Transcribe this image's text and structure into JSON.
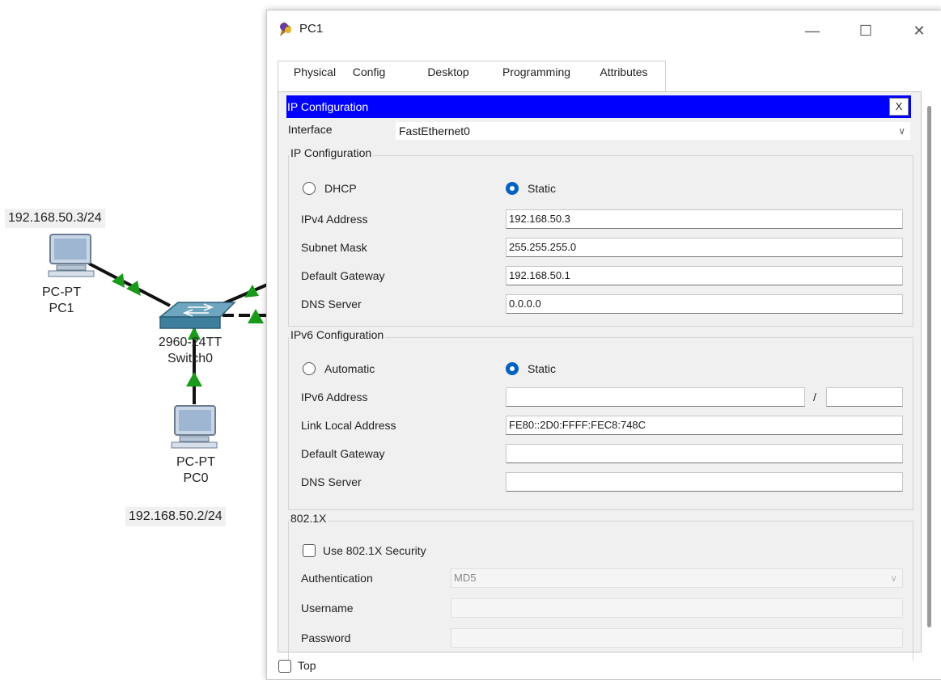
{
  "topology": {
    "pc1_ip": "192.168.50.3/24",
    "pc1_type": "PC-PT",
    "pc1_name": "PC1",
    "switch_model": "2960-24TT",
    "switch_name": "Switch0",
    "pc0_type": "PC-PT",
    "pc0_name": "PC0",
    "pc0_ip": "192.168.50.2/24"
  },
  "window": {
    "title": "PC1",
    "minimize": "—",
    "maximize": "☐",
    "close": "✕"
  },
  "tabs": [
    {
      "label": "Physical"
    },
    {
      "label": "Config"
    },
    {
      "label": "Desktop"
    },
    {
      "label": "Programming"
    },
    {
      "label": "Attributes"
    }
  ],
  "active_tab": "Desktop",
  "ip_config": {
    "header": "IP Configuration",
    "close_label": "X",
    "interface_label": "Interface",
    "interface_value": "FastEthernet0",
    "ipv4_group": {
      "title": "IP Configuration",
      "dhcp_label": "DHCP",
      "static_label": "Static",
      "mode": "Static",
      "ipv4_label": "IPv4 Address",
      "ipv4_value": "192.168.50.3",
      "mask_label": "Subnet Mask",
      "mask_value": "255.255.255.0",
      "gateway_label": "Default Gateway",
      "gateway_value": "192.168.50.1",
      "dns_label": "DNS Server",
      "dns_value": "0.0.0.0"
    },
    "ipv6_group": {
      "title": "IPv6 Configuration",
      "auto_label": "Automatic",
      "static_label": "Static",
      "mode": "Static",
      "ipv6_label": "IPv6 Address",
      "ipv6_value": "",
      "prefix_sep": "/",
      "prefix_value": "",
      "link_local_label": "Link Local Address",
      "link_local_value": "FE80::2D0:FFFF:FEC8:748C",
      "gateway_label": "Default Gateway",
      "gateway_value": "",
      "dns_label": "DNS Server",
      "dns_value": ""
    },
    "dot1x_group": {
      "title": "802.1X",
      "use_label": "Use 802.1X Security",
      "use_checked": false,
      "auth_label": "Authentication",
      "auth_value": "MD5",
      "user_label": "Username",
      "user_value": "",
      "pass_label": "Password",
      "pass_value": ""
    }
  },
  "footer": {
    "top_label": "Top",
    "top_checked": false
  },
  "colors": {
    "header_blue": "#0000ff",
    "radio_blue": "#0063c1",
    "link_green": "#0a7a0a",
    "active_tab_underline": "#1a3d7c"
  }
}
